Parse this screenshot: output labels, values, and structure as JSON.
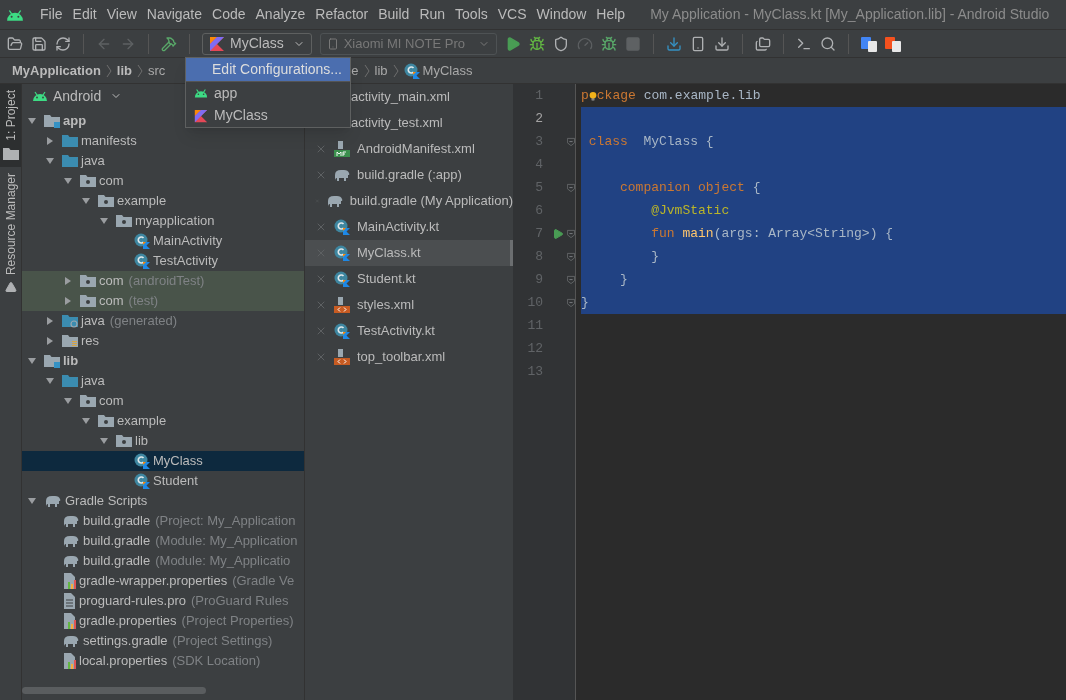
{
  "menu_bar": {
    "items": [
      "File",
      "Edit",
      "View",
      "Navigate",
      "Code",
      "Analyze",
      "Refactor",
      "Build",
      "Run",
      "Tools",
      "VCS",
      "Window",
      "Help"
    ],
    "title": "My Application - MyClass.kt [My_Application.lib] - Android Studio"
  },
  "toolbar": {
    "run_config": {
      "label": "MyClass"
    },
    "device": {
      "label": "Xiaomi MI NOTE Pro",
      "disabled": true
    }
  },
  "breadcrumb": [
    {
      "text": "MyApplication",
      "bold": true
    },
    {
      "text": "lib",
      "bold": true
    },
    {
      "text": "src",
      "bold": false
    },
    {
      "text": "e",
      "bold": false
    },
    {
      "text": "lib",
      "bold": false
    },
    {
      "text": "MyClass",
      "bold": false,
      "kind": "class"
    }
  ],
  "run_config_menu": [
    {
      "label": "Edit Configurations...",
      "kind": "action",
      "selected": true
    },
    {
      "label": "app",
      "kind": "android",
      "selected": false
    },
    {
      "label": "MyClass",
      "kind": "kotlin",
      "selected": false
    }
  ],
  "tool_strip": [
    {
      "label": "1: Project",
      "selected": true,
      "kind": "folder"
    },
    {
      "label": "Resource Manager",
      "selected": false,
      "kind": "shapes"
    }
  ],
  "project_panel": {
    "view": "Android",
    "tree": [
      {
        "name": "app",
        "kind": "module",
        "expanded": true,
        "selected": false,
        "children": [
          {
            "name": "manifests",
            "kind": "folder",
            "expanded": false,
            "selected": false
          },
          {
            "name": "java",
            "kind": "folder",
            "expanded": true,
            "selected": false,
            "children": [
              {
                "name": "com",
                "kind": "package",
                "expanded": true,
                "selected": false,
                "children": [
                  {
                    "name": "example",
                    "kind": "package",
                    "expanded": true,
                    "selected": false,
                    "children": [
                      {
                        "name": "myapplication",
                        "kind": "package",
                        "expanded": true,
                        "selected": false,
                        "children": [
                          {
                            "name": "MainActivity",
                            "kind": "class",
                            "selected": false
                          },
                          {
                            "name": "TestActivity",
                            "kind": "class",
                            "selected": false
                          }
                        ]
                      }
                    ]
                  }
                ]
              },
              {
                "name": "com",
                "hint": "(androidTest)",
                "kind": "test-package",
                "expanded": false,
                "selected": false
              },
              {
                "name": "com",
                "hint": "(test)",
                "kind": "test-package",
                "expanded": false,
                "selected": false
              }
            ]
          },
          {
            "name": "java",
            "hint": "(generated)",
            "kind": "generated",
            "expanded": false,
            "selected": false
          },
          {
            "name": "res",
            "kind": "res",
            "expanded": false,
            "selected": false
          }
        ]
      },
      {
        "name": "lib",
        "kind": "module",
        "expanded": true,
        "selected": false,
        "children": [
          {
            "name": "java",
            "kind": "folder",
            "expanded": true,
            "selected": false,
            "children": [
              {
                "name": "com",
                "kind": "package",
                "expanded": true,
                "selected": false,
                "children": [
                  {
                    "name": "example",
                    "kind": "package",
                    "expanded": true,
                    "selected": false,
                    "children": [
                      {
                        "name": "lib",
                        "kind": "package",
                        "expanded": true,
                        "selected": false,
                        "children": [
                          {
                            "name": "MyClass",
                            "kind": "class",
                            "selected": true
                          },
                          {
                            "name": "Student",
                            "kind": "class",
                            "selected": false
                          }
                        ]
                      }
                    ]
                  }
                ]
              }
            ]
          }
        ]
      },
      {
        "name": "Gradle Scripts",
        "kind": "gradle-group",
        "expanded": true,
        "selected": false,
        "children": [
          {
            "name": "build.gradle",
            "hint": "(Project: My_Application",
            "kind": "gradle",
            "selected": false
          },
          {
            "name": "build.gradle",
            "hint": "(Module: My_Application",
            "kind": "gradle",
            "selected": false
          },
          {
            "name": "build.gradle",
            "hint": "(Module: My_Applicatio",
            "kind": "gradle",
            "selected": false
          },
          {
            "name": "gradle-wrapper.properties",
            "hint": "(Gradle Ve",
            "kind": "properties",
            "selected": false
          },
          {
            "name": "proguard-rules.pro",
            "hint": "(ProGuard Rules",
            "kind": "text",
            "selected": false
          },
          {
            "name": "gradle.properties",
            "hint": "(Project Properties)",
            "kind": "properties",
            "selected": false
          },
          {
            "name": "settings.gradle",
            "hint": "(Project Settings)",
            "kind": "gradle",
            "selected": false
          },
          {
            "name": "local.properties",
            "hint": "(SDK Location)",
            "kind": "properties",
            "selected": false
          }
        ]
      }
    ]
  },
  "recent_files": [
    {
      "name": "activity_main.xml",
      "obscured": true,
      "selected": false
    },
    {
      "name": "activity_test.xml",
      "obscured": true,
      "selected": false
    },
    {
      "name": "AndroidManifest.xml",
      "kind": "manifest",
      "obscured": false,
      "selected": false
    },
    {
      "name": "build.gradle (:app)",
      "kind": "gradle",
      "obscured": false,
      "selected": false
    },
    {
      "name": "build.gradle (My Application)",
      "kind": "gradle",
      "obscured": false,
      "selected": false
    },
    {
      "name": "MainActivity.kt",
      "kind": "class",
      "obscured": false,
      "selected": false
    },
    {
      "name": "MyClass.kt",
      "kind": "class",
      "obscured": false,
      "selected": true
    },
    {
      "name": "Student.kt",
      "kind": "class",
      "obscured": false,
      "selected": false
    },
    {
      "name": "styles.xml",
      "kind": "xml",
      "obscured": false,
      "selected": false
    },
    {
      "name": "TestActivity.kt",
      "kind": "class",
      "obscured": false,
      "selected": false
    },
    {
      "name": "top_toolbar.xml",
      "kind": "xml",
      "obscured": false,
      "selected": false
    }
  ],
  "editor": {
    "lines": [
      {
        "number": "1",
        "selected": false,
        "current": false,
        "fold": false,
        "run": false,
        "tokens": [
          {
            "text": "p",
            "kind": "keyword"
          },
          {
            "kind": "bulb"
          },
          {
            "text": "ckage",
            "kind": "keyword"
          },
          {
            "text": " com.example.lib",
            "kind": "plain"
          }
        ]
      },
      {
        "number": "2",
        "selected": true,
        "current": true,
        "fold": false,
        "run": false
      },
      {
        "number": "3",
        "selected": true,
        "current": false,
        "fold": true,
        "run": false,
        "tokens": [
          {
            "text": " class",
            "kind": "keyword"
          },
          {
            "text": "  MyClass {",
            "kind": "plain"
          }
        ]
      },
      {
        "number": "4",
        "selected": true,
        "current": false,
        "fold": false,
        "run": false
      },
      {
        "number": "5",
        "selected": true,
        "current": false,
        "fold": true,
        "run": false,
        "tokens": [
          {
            "text": "     companion object",
            "kind": "keyword"
          },
          {
            "text": " {",
            "kind": "plain"
          }
        ]
      },
      {
        "number": "6",
        "selected": true,
        "current": false,
        "fold": false,
        "run": false,
        "tokens": [
          {
            "text": "         @JvmStatic",
            "kind": "annotation"
          }
        ]
      },
      {
        "number": "7",
        "selected": true,
        "current": false,
        "fold": true,
        "run": true,
        "tokens": [
          {
            "text": "         fun ",
            "kind": "keyword"
          },
          {
            "text": "main",
            "kind": "function"
          },
          {
            "text": "(args: Array<String>) {",
            "kind": "plain"
          }
        ]
      },
      {
        "number": "8",
        "selected": true,
        "current": false,
        "fold": true,
        "run": false,
        "tokens": [
          {
            "text": "         }",
            "kind": "plain"
          }
        ]
      },
      {
        "number": "9",
        "selected": true,
        "current": false,
        "fold": true,
        "run": false,
        "tokens": [
          {
            "text": "     }",
            "kind": "plain"
          }
        ]
      },
      {
        "number": "10",
        "selected": true,
        "current": false,
        "fold": true,
        "run": false,
        "tokens": [
          {
            "text": "}",
            "kind": "plain"
          }
        ]
      },
      {
        "number": "11",
        "selected": false,
        "current": false,
        "fold": false,
        "run": false
      },
      {
        "number": "12",
        "selected": false,
        "current": false,
        "fold": false,
        "run": false
      },
      {
        "number": "13",
        "selected": false,
        "current": false,
        "fold": false,
        "run": false
      }
    ]
  }
}
